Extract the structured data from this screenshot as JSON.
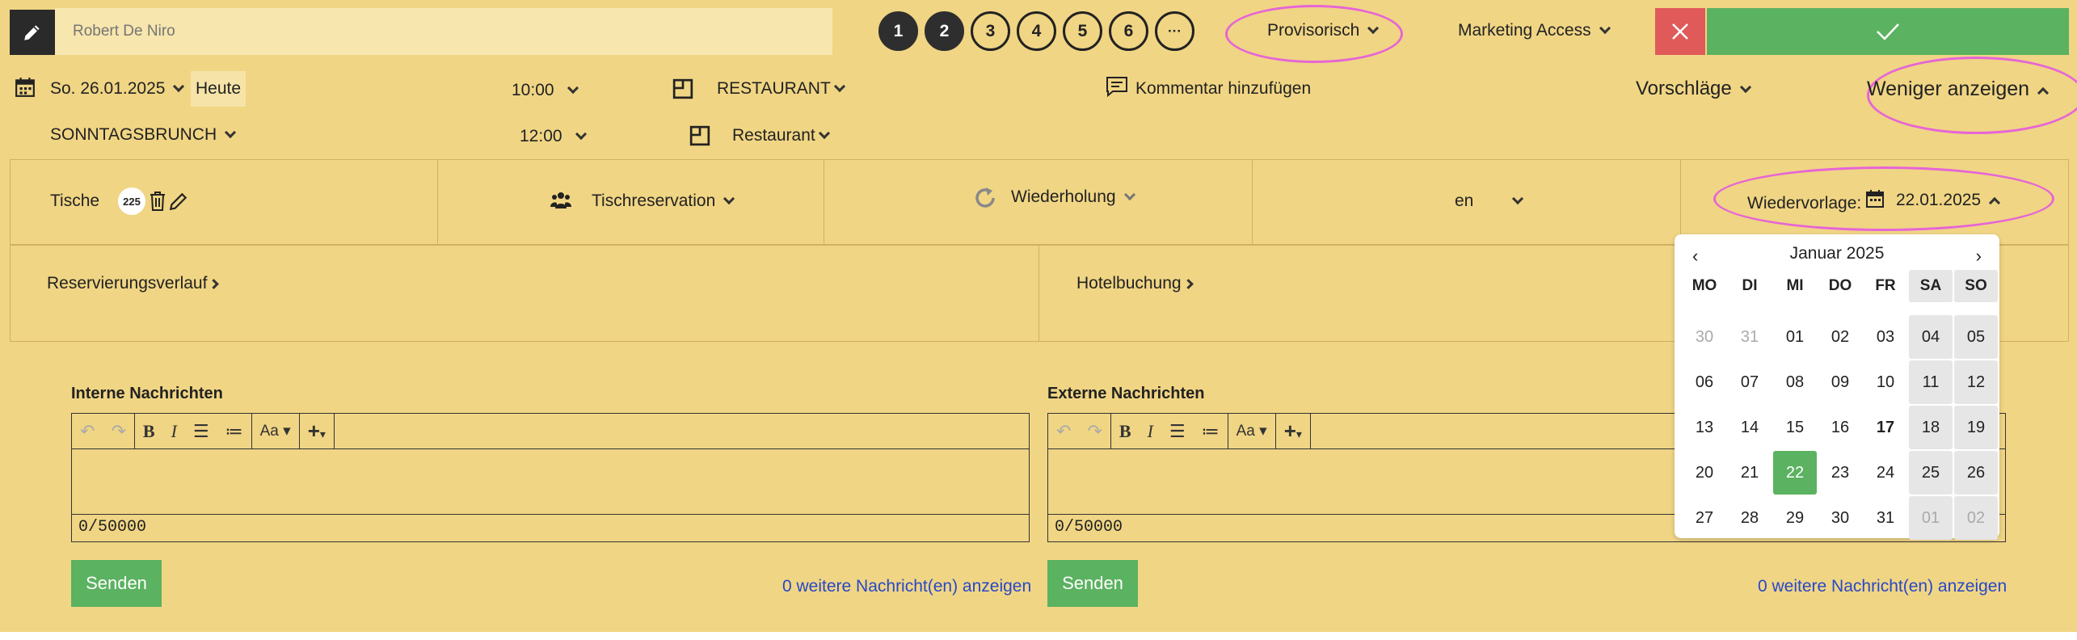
{
  "guest": {
    "name_placeholder": "Robert De Niro"
  },
  "steps": [
    "1",
    "2",
    "3",
    "4",
    "5",
    "6",
    "···"
  ],
  "status": {
    "label": "Provisorisch"
  },
  "marketing": {
    "label": "Marketing Access"
  },
  "datetime": {
    "date": "So. 26.01.2025",
    "today_label": "Heute",
    "time_start": "10:00",
    "time_end": "12:00",
    "venue": "RESTAURANT",
    "venue_sub": "Restaurant",
    "event": "SONNTAGSBRUNCH"
  },
  "comment": {
    "label": "Kommentar hinzufügen"
  },
  "suggestions": {
    "label": "Vorschläge"
  },
  "less": {
    "label": "Weniger anzeigen"
  },
  "details": {
    "tables_label": "Tische",
    "table_badge": "225",
    "type_label": "Tischreservation",
    "repeat_label": "Wiederholung",
    "language": "en",
    "followup_label": "Wiedervorlage:",
    "followup_date": "22.01.2025"
  },
  "links": {
    "history": "Reservierungsverlauf",
    "hotel": "Hotelbuchung"
  },
  "internal": {
    "title": "Interne Nachrichten",
    "counter": "0/50000",
    "send": "Senden",
    "more": "0 weitere Nachricht(en) anzeigen"
  },
  "external": {
    "title": "Externe Nachrichten",
    "counter": "0/50000",
    "send": "Senden",
    "more": "0 weitere Nachricht(en) anzeigen"
  },
  "toolbar": {
    "font_label": "Aa"
  },
  "calendar": {
    "month": "Januar 2025",
    "weekdays": [
      "MO",
      "DI",
      "MI",
      "DO",
      "FR",
      "SA",
      "SO"
    ],
    "weeks": [
      [
        "30",
        "31",
        "01",
        "02",
        "03",
        "04",
        "05"
      ],
      [
        "06",
        "07",
        "08",
        "09",
        "10",
        "11",
        "12"
      ],
      [
        "13",
        "14",
        "15",
        "16",
        "17",
        "18",
        "19"
      ],
      [
        "20",
        "21",
        "22",
        "23",
        "24",
        "25",
        "26"
      ],
      [
        "27",
        "28",
        "29",
        "30",
        "31",
        "01",
        "02"
      ]
    ],
    "selected": "22",
    "today": "17"
  },
  "colors": {
    "background": "#f0d584",
    "accent_green": "#5bb260",
    "danger_red": "#e05a5a",
    "highlight_magenta": "#e665d6",
    "link_blue": "#2848c8"
  }
}
